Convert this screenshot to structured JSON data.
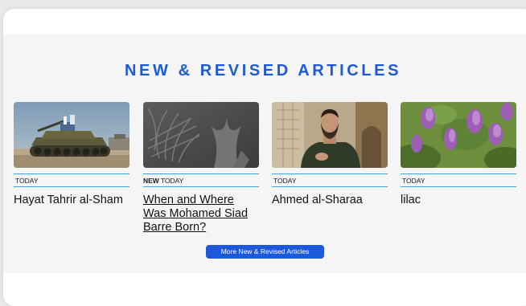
{
  "section": {
    "title": "NEW & REVISED ARTICLES"
  },
  "articles": [
    {
      "new_label": "",
      "date": "TODAY",
      "title": "Hayat Tahrir al-Sham",
      "image": "tank-image"
    },
    {
      "new_label": "NEW",
      "date": "TODAY",
      "title": "When and Where Was Mohamed Siad Barre Born?",
      "image": "thistle-placeholder-image"
    },
    {
      "new_label": "",
      "date": "TODAY",
      "title": "Ahmed al-Sharaa",
      "image": "portrait-image"
    },
    {
      "new_label": "",
      "date": "TODAY",
      "title": "lilac",
      "image": "lilac-flowers-image"
    }
  ],
  "more_button": {
    "label": "More New & Revised Articles"
  },
  "colors": {
    "accent": "#1d5bd6",
    "rule": "#3aa9d9",
    "button": "#1b59d8"
  }
}
